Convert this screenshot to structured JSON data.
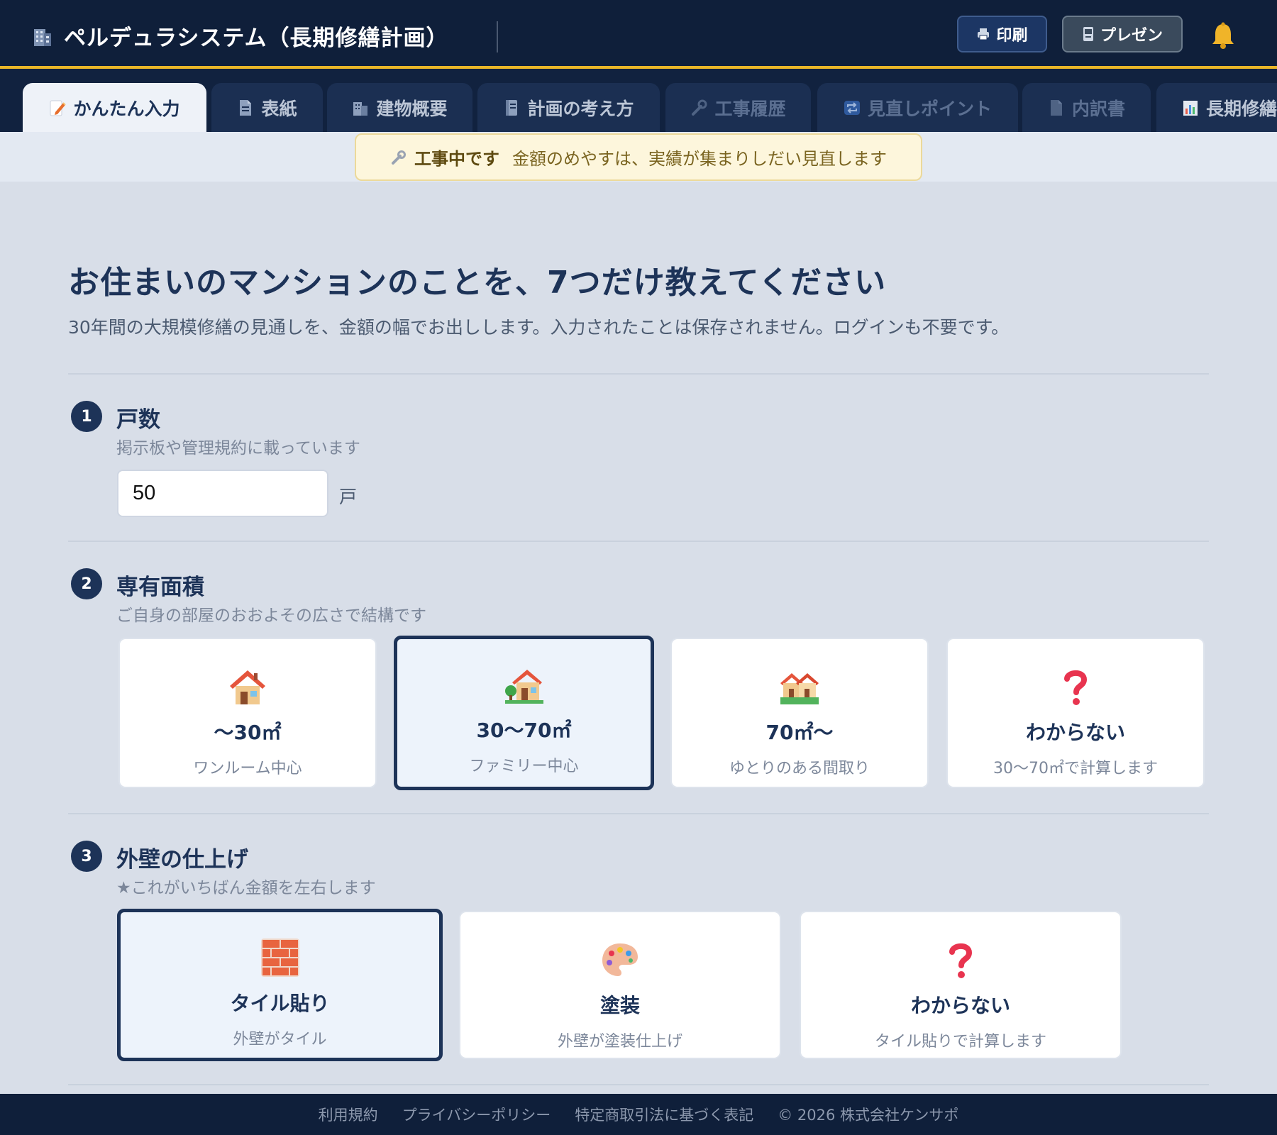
{
  "header": {
    "title": "ペルデュラシステム（長期修繕計画）",
    "icon": "building-icon",
    "print_label": "印刷",
    "present_label": "プレゼン",
    "accent_color": "#e9b628"
  },
  "tabs": [
    {
      "label": "かんたん入力",
      "icon": "memo-icon",
      "active": true
    },
    {
      "label": "表紙",
      "icon": "document-icon"
    },
    {
      "label": "建物概要",
      "icon": "building-icon"
    },
    {
      "label": "計画の考え方",
      "icon": "notebook-icon"
    },
    {
      "label": "工事履歴",
      "icon": "wrench-icon"
    },
    {
      "label": "見直しポイント",
      "icon": "repeat-icon"
    },
    {
      "label": "内訳書",
      "icon": "document-icon"
    },
    {
      "label": "長期修繕",
      "icon": "chart-icon"
    }
  ],
  "notice": {
    "strong": "工事中です",
    "text": "金額のめやすは、実績が集まりしだい見直します"
  },
  "main": {
    "title": "お住まいのマンションのことを、7つだけ教えてください",
    "description": "30年間の大規模修繕の見通しを、金額の幅でお出しします。入力されたことは保存されません。ログインも不要です。"
  },
  "questions": [
    {
      "number": "1",
      "title": "戸数",
      "subtitle": "掲示板や管理規約に載っています",
      "value": "50",
      "unit": "戸"
    },
    {
      "number": "2",
      "title": "専有面積",
      "subtitle": "ご自身の部屋のおおよその広さで結構です",
      "options": [
        {
          "label": "〜30㎡",
          "sub": "ワンルーム中心",
          "icon": "house-icon",
          "selected": false
        },
        {
          "label": "30〜70㎡",
          "sub": "ファミリー中心",
          "icon": "house-with-garden-icon",
          "selected": true
        },
        {
          "label": "70㎡〜",
          "sub": "ゆとりのある間取り",
          "icon": "houses-icon",
          "selected": false
        },
        {
          "label": "わからない",
          "sub": "30〜70㎡で計算します",
          "icon": "question-icon",
          "selected": false
        }
      ]
    },
    {
      "number": "3",
      "title": "外壁の仕上げ",
      "subtitle": "★これがいちばん金額を左右します",
      "options": [
        {
          "label": "タイル貼り",
          "sub": "外壁がタイル",
          "icon": "brick-icon",
          "selected": true
        },
        {
          "label": "塗装",
          "sub": "外壁が塗装仕上げ",
          "icon": "palette-icon",
          "selected": false
        },
        {
          "label": "わからない",
          "sub": "タイル貼りで計算します",
          "icon": "question-icon",
          "selected": false
        }
      ]
    }
  ],
  "footer": {
    "links": [
      "利用規約",
      "プライバシーポリシー",
      "特定商取引法に基づく表記"
    ],
    "copyright": "© 2026 株式会社ケンサポ"
  }
}
